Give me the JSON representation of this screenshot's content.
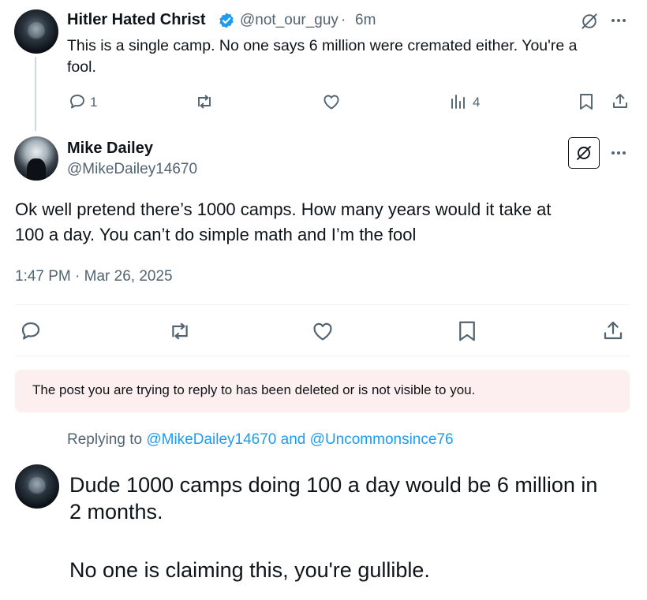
{
  "post1": {
    "author_name": "Hitler Hated Christ",
    "author_handle": "@not_our_guy",
    "time": "6m",
    "text_line1": "This is a single camp. No one says 6 million were cremated either. You're a",
    "text_line2": "fool.",
    "reply_count": "1",
    "views_count": "4"
  },
  "post2": {
    "author_name": "Mike Dailey",
    "author_handle": "@MikeDailey14670",
    "text_line1": "Ok well pretend there’s 1000 camps. How many years would it take at",
    "text_line2": "100 a day. You can’t do simple math and I’m the fool",
    "timestamp": "1:47 PM · Mar 26, 2025"
  },
  "notice": {
    "text": "The post you are trying to reply to has been deleted or is not visible to you."
  },
  "reply": {
    "replying_to_label": "Replying to",
    "mention1": "@MikeDailey14670",
    "and_label": "and",
    "mention2": "@Uncommonsince76",
    "text_line1": "Dude 1000 camps doing 100 a day would be 6 million in",
    "text_line2": "2 months.",
    "text_line3": "No one is claiming this, you're gullible."
  },
  "colors": {
    "text": "#0f1419",
    "secondary": "#536471",
    "accent": "#1d9bf0",
    "notice_bg": "#fdeff0",
    "divider": "#eff3f4"
  },
  "icons": [
    "verified-badge-icon",
    "grok-icon",
    "more-icon",
    "reply-icon",
    "repost-icon",
    "like-icon",
    "views-icon",
    "bookmark-icon",
    "share-icon"
  ]
}
